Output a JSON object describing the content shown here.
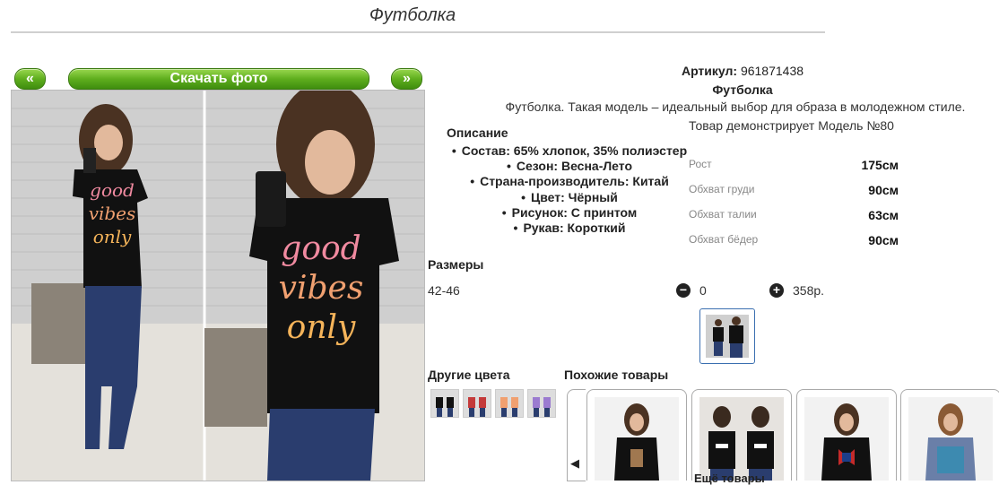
{
  "page": {
    "title": "Футболка"
  },
  "photo": {
    "prev_label": "«",
    "download_label": "Скачать фото",
    "next_label": "»"
  },
  "product": {
    "article_label": "Артикул:",
    "article_value": "961871438",
    "name": "Футболка",
    "description": "Футболка. Такая модель – идеальный выбор для образа в молодежном стиле.",
    "model_text": "Товар демонстрирует Модель №80",
    "description_heading": "Описание",
    "attributes": [
      "Состав: 65% хлопок, 35% полиэстер",
      "Сезон: Весна-Лето",
      "Страна-производитель: Китай",
      "Цвет: Чёрный",
      "Рисунок: С принтом",
      "Рукав: Короткий"
    ],
    "measurements": [
      {
        "label": "Рост",
        "value": "175см"
      },
      {
        "label": "Обхват груди",
        "value": "90см"
      },
      {
        "label": "Обхват талии",
        "value": "63см"
      },
      {
        "label": "Обхват бёдер",
        "value": "90см"
      }
    ]
  },
  "sizes": {
    "heading": "Размеры",
    "size": "42-46",
    "minus_symbol": "−",
    "quantity": "0",
    "plus_symbol": "+",
    "price": "358р."
  },
  "other_colors": {
    "heading": "Другие цвета"
  },
  "similar": {
    "heading": "Похожие товары",
    "prev_symbol": "◀",
    "more_label": "Ещё товары"
  },
  "colors": {
    "accent_green": "#5fae1e",
    "selected_border": "#3a6fb0",
    "shirt": "#111111"
  }
}
